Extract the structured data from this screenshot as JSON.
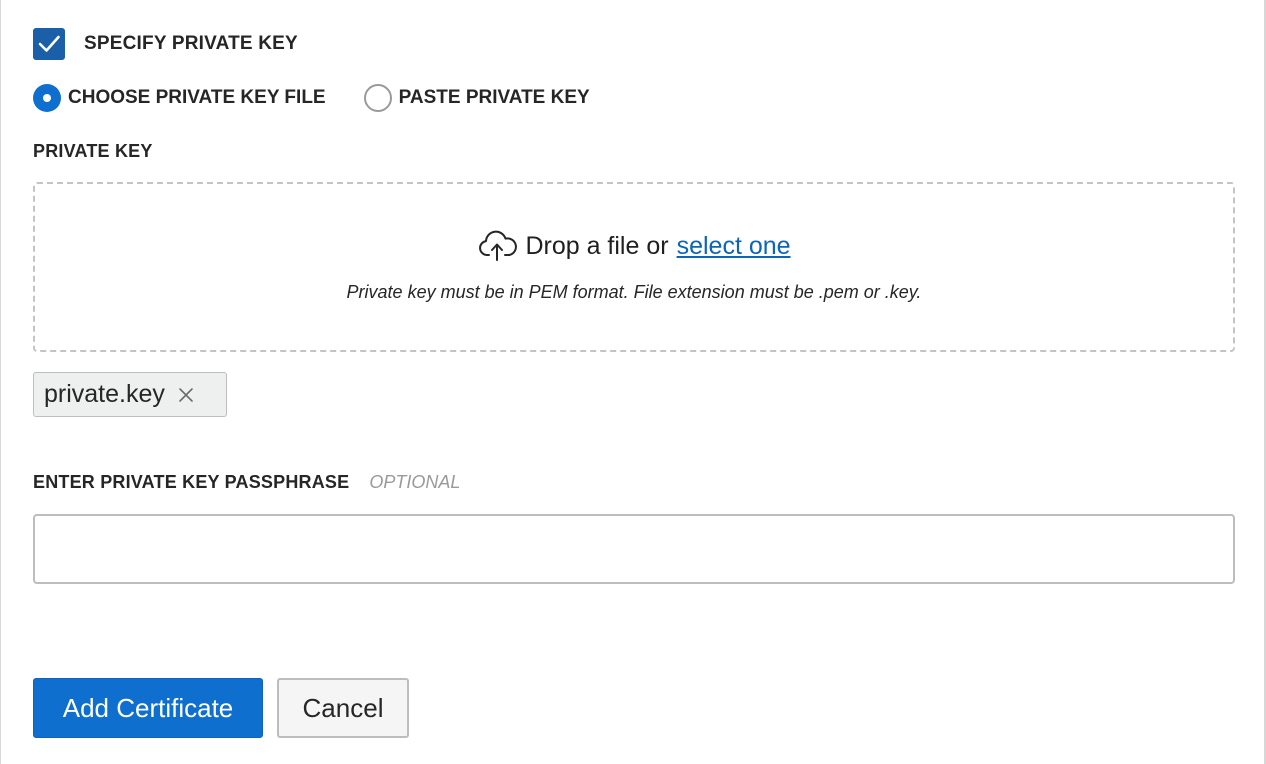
{
  "specify": {
    "label": "SPECIFY PRIVATE KEY",
    "checked": true
  },
  "source_options": [
    {
      "label": "CHOOSE PRIVATE KEY FILE",
      "selected": true
    },
    {
      "label": "PASTE PRIVATE KEY",
      "selected": false
    }
  ],
  "private_key": {
    "label": "PRIVATE KEY",
    "drop_text": "Drop a file or",
    "drop_link": "select one",
    "hint": "Private key must be in PEM format. File extension must be .pem or .key.",
    "file_name": "private.key"
  },
  "passphrase": {
    "label": "ENTER PRIVATE KEY PASSPHRASE",
    "optional": "OPTIONAL",
    "value": ""
  },
  "actions": {
    "primary": "Add Certificate",
    "secondary": "Cancel"
  },
  "colors": {
    "accent": "#0f6fcf",
    "checkbox": "#1a5fa8",
    "link": "#0b65b8"
  },
  "icons": {
    "checkbox": "checkmark-icon",
    "upload": "cloud-upload-icon",
    "remove": "close-icon"
  }
}
